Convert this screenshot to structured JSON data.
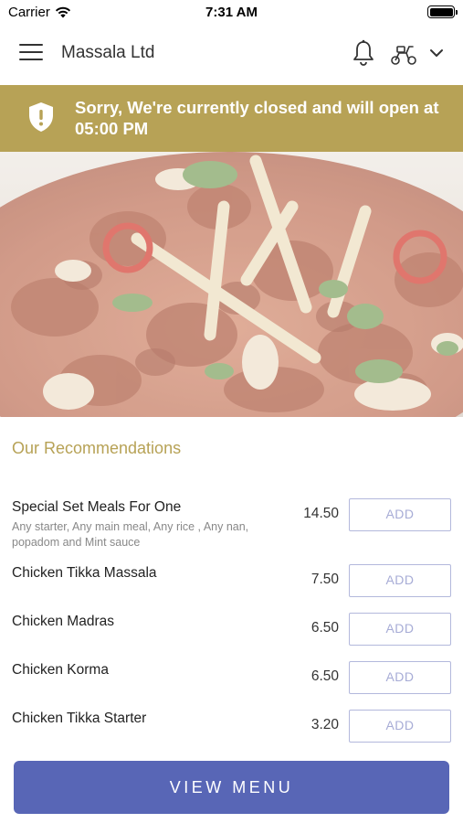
{
  "status_bar": {
    "carrier": "Carrier",
    "time": "7:31 AM"
  },
  "header": {
    "title": "Massala Ltd",
    "icons": [
      "menu-icon",
      "bell-icon",
      "scooter-icon",
      "chevron-down-icon"
    ]
  },
  "banner": {
    "message": "Sorry, We're currently closed and will open at 05:00 PM",
    "icon": "shield-alert-icon",
    "color": "#b7a256"
  },
  "recommendations": {
    "title": "Our Recommendations",
    "items": [
      {
        "name": "Special Set Meals For One",
        "description": "Any starter, Any main meal, Any rice , Any nan, popadom and Mint sauce",
        "price": "14.50",
        "action": "ADD"
      },
      {
        "name": "Chicken Tikka Massala",
        "description": "",
        "price": "7.50",
        "action": "ADD"
      },
      {
        "name": "Chicken Madras",
        "description": "",
        "price": "6.50",
        "action": "ADD"
      },
      {
        "name": "Chicken Korma",
        "description": "",
        "price": "6.50",
        "action": "ADD"
      },
      {
        "name": "Chicken Tikka Starter",
        "description": "",
        "price": "3.20",
        "action": "ADD"
      }
    ]
  },
  "footer": {
    "button_label": "VIEW MENU",
    "color": "#5866b6"
  }
}
